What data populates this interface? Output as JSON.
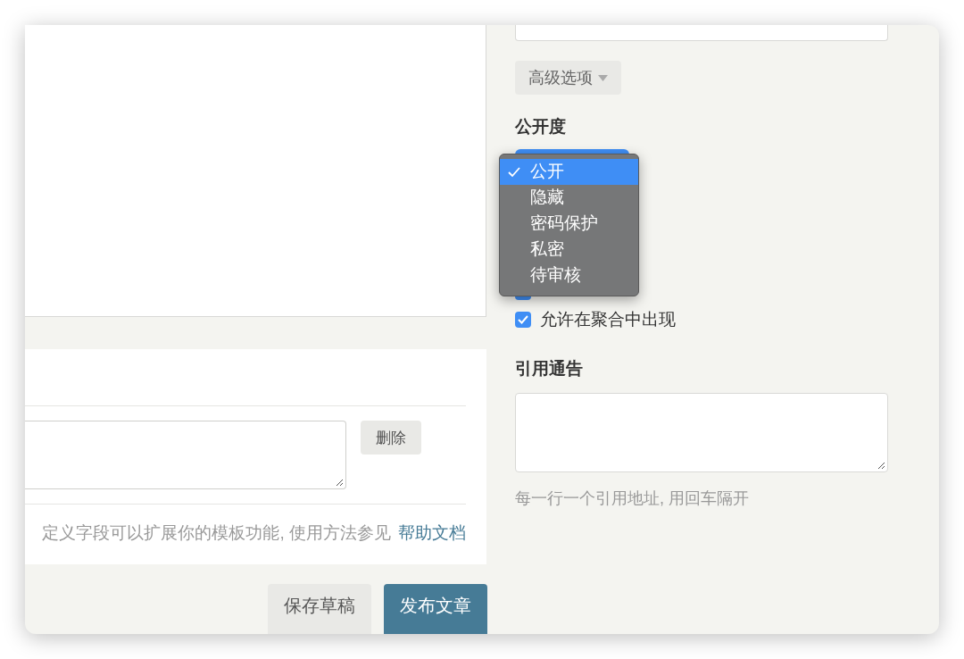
{
  "advanced_button": {
    "label": "高级选项"
  },
  "visibility": {
    "label": "公开度",
    "options": [
      {
        "label": "公开",
        "selected": true
      },
      {
        "label": "隐藏",
        "selected": false
      },
      {
        "label": "密码保护",
        "selected": false
      },
      {
        "label": "私密",
        "selected": false
      },
      {
        "label": "待审核",
        "selected": false
      }
    ]
  },
  "permissions": [
    {
      "checked": true
    },
    {
      "label": "允许在聚合中出现",
      "checked": true
    }
  ],
  "trackback": {
    "label": "引用通告",
    "hint": "每一行一个引用地址, 用回车隔开"
  },
  "custom_fields": {
    "delete_button": "删除",
    "help_text": "定义字段可以扩展你的模板功能, 使用方法参见",
    "help_link": "帮助文档"
  },
  "actions": [
    {
      "label": "保存草稿",
      "kind": "secondary"
    },
    {
      "label": "发布文章",
      "kind": "primary"
    }
  ]
}
